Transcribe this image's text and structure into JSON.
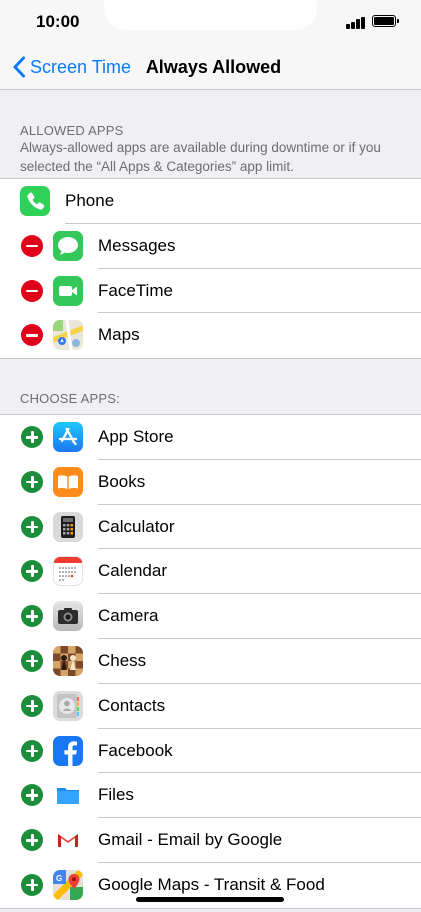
{
  "status_bar": {
    "time": "10:00"
  },
  "nav": {
    "back_label": "Screen Time",
    "title": "Always Allowed"
  },
  "allowed_section": {
    "header": "ALLOWED APPS",
    "description": "Always-allowed apps are available during downtime or if you selected the “All Apps & Categories” app limit.",
    "apps": [
      {
        "name": "Phone",
        "icon": "phone-icon",
        "removable": false
      },
      {
        "name": "Messages",
        "icon": "messages-icon",
        "removable": true
      },
      {
        "name": "FaceTime",
        "icon": "facetime-icon",
        "removable": true
      },
      {
        "name": "Maps",
        "icon": "maps-icon",
        "removable": true
      }
    ]
  },
  "choose_section": {
    "header": "CHOOSE APPS:",
    "apps": [
      {
        "name": "App Store",
        "icon": "app-store-icon"
      },
      {
        "name": "Books",
        "icon": "books-icon"
      },
      {
        "name": "Calculator",
        "icon": "calculator-icon"
      },
      {
        "name": "Calendar",
        "icon": "calendar-icon"
      },
      {
        "name": "Camera",
        "icon": "camera-icon"
      },
      {
        "name": "Chess",
        "icon": "chess-icon"
      },
      {
        "name": "Contacts",
        "icon": "contacts-icon"
      },
      {
        "name": "Facebook",
        "icon": "facebook-icon"
      },
      {
        "name": "Files",
        "icon": "files-icon"
      },
      {
        "name": "Gmail - Email by Google",
        "icon": "gmail-icon"
      },
      {
        "name": "Google Maps - Transit & Food",
        "icon": "google-maps-icon"
      }
    ]
  },
  "colors": {
    "accent": "#0a7aff",
    "remove": "#e0001a",
    "add": "#1c8d3a"
  }
}
